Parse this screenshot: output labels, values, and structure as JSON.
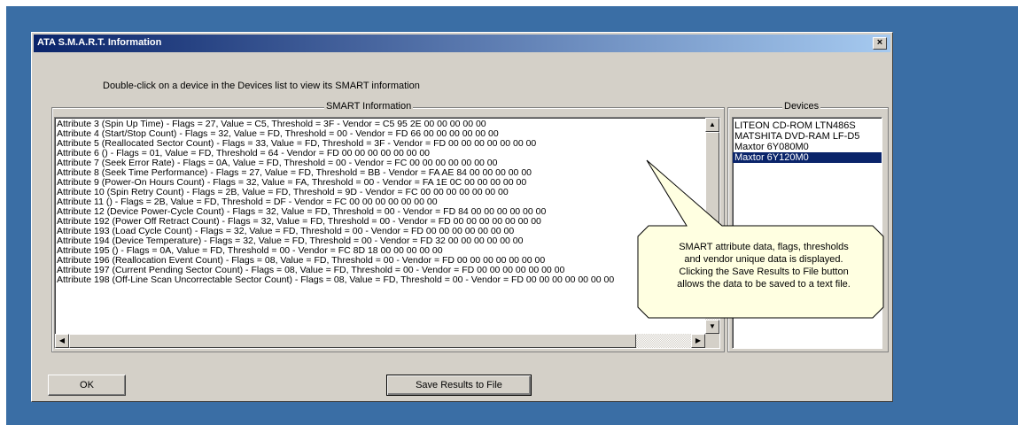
{
  "window": {
    "title": "ATA S.M.A.R.T. Information",
    "close_glyph": "×"
  },
  "instruction": "Double-click on a device in the Devices list to view its SMART information",
  "smart_panel": {
    "label": "SMART Information",
    "lines": [
      "Attribute 3 (Spin Up Time) - Flags = 27, Value = C5, Threshold = 3F - Vendor = C5 95 2E 00 00 00 00 00",
      "Attribute 4 (Start/Stop Count) - Flags = 32, Value = FD, Threshold = 00 - Vendor = FD 66 00 00 00 00 00 00",
      "Attribute 5 (Reallocated Sector Count) - Flags = 33, Value = FD, Threshold = 3F - Vendor = FD 00 00 00 00 00 00 00",
      "Attribute 6 () - Flags = 01, Value = FD, Threshold = 64 - Vendor = FD 00 00 00 00 00 00 00",
      "Attribute 7 (Seek Error Rate) - Flags = 0A, Value = FD, Threshold = 00 - Vendor = FC 00 00 00 00 00 00 00",
      "Attribute 8 (Seek Time Performance) - Flags = 27, Value = FD, Threshold = BB - Vendor = FA AE 84 00 00 00 00 00",
      "Attribute 9 (Power-On Hours Count) - Flags = 32, Value = FA, Threshold = 00 - Vendor = FA 1E 0C 00 00 00 00 00",
      "Attribute 10 (Spin Retry Count) - Flags = 2B, Value = FD, Threshold = 9D - Vendor = FC 00 00 00 00 00 00 00",
      "Attribute 11 () - Flags = 2B, Value = FD, Threshold = DF - Vendor = FC 00 00 00 00 00 00 00",
      "Attribute 12 (Device Power-Cycle Count) - Flags = 32, Value = FD, Threshold = 00 - Vendor = FD 84 00 00 00 00 00 00",
      "Attribute 192 (Power Off Retract Count) - Flags = 32, Value = FD, Threshold = 00 - Vendor = FD 00 00 00 00 00 00 00",
      "Attribute 193 (Load Cycle Count) - Flags = 32, Value = FD, Threshold = 00 - Vendor = FD 00 00 00 00 00 00 00",
      "Attribute 194 (Device Temperature) - Flags = 32, Value = FD, Threshold = 00 - Vendor = FD 32 00 00 00 00 00 00",
      "Attribute 195 () - Flags = 0A, Value = FD, Threshold = 00 - Vendor = FC 8D 18 00 00 00 00 00",
      "Attribute 196 (Reallocation Event Count) - Flags = 08, Value = FD, Threshold = 00 - Vendor = FD 00 00 00 00 00 00 00",
      "Attribute 197 (Current Pending Sector Count) - Flags = 08, Value = FD, Threshold = 00 - Vendor = FD 00 00 00 00 00 00 00",
      "Attribute 198 (Off-Line Scan Uncorrectable Sector Count) - Flags = 08, Value = FD, Threshold = 00 - Vendor = FD 00 00 00 00 00 00 00"
    ],
    "scroll_up_glyph": "▲",
    "scroll_down_glyph": "▼",
    "scroll_left_glyph": "◀",
    "scroll_right_glyph": "▶"
  },
  "devices_panel": {
    "label": "Devices",
    "items": [
      {
        "label": "LITEON CD-ROM LTN486S",
        "selected": false
      },
      {
        "label": "MATSHITA DVD-RAM LF-D5",
        "selected": false
      },
      {
        "label": "Maxtor 6Y080M0",
        "selected": false
      },
      {
        "label": "Maxtor 6Y120M0",
        "selected": true
      }
    ]
  },
  "callout": {
    "lines": [
      "SMART attribute data, flags, thresholds",
      "and vendor unique data is displayed.",
      "Clicking the Save Results to File button",
      "allows the data to be saved to a text file."
    ]
  },
  "buttons": {
    "ok_label": "OK",
    "save_label": "Save Results to File"
  },
  "colors": {
    "desktop": "#3a6ea5",
    "dialog": "#d4d0c8",
    "title_start": "#0a246a",
    "selection": "#0a246a",
    "callout_fill": "#ffffe1"
  }
}
